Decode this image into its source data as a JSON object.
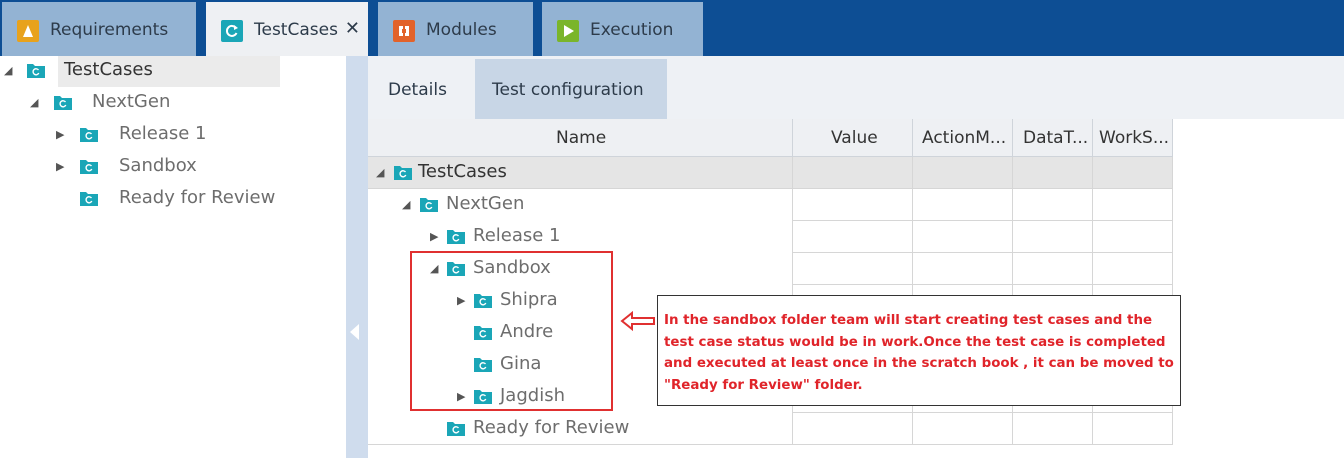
{
  "tabs": [
    {
      "label": "Requirements",
      "icon": "requirements-icon",
      "color": "#e8a21c",
      "active": false
    },
    {
      "label": "TestCases",
      "icon": "testcases-icon",
      "color": "#1aa6b7",
      "active": true,
      "close": "✕"
    },
    {
      "label": "Modules",
      "icon": "modules-icon",
      "color": "#e2622a",
      "active": false
    },
    {
      "label": "Execution",
      "icon": "execution-icon",
      "color": "#7ab52a",
      "active": false
    }
  ],
  "tree": {
    "root": "TestCases",
    "nextgen": "NextGen",
    "release1": "Release 1",
    "sandbox": "Sandbox",
    "ready": "Ready for Review"
  },
  "details_tabs": [
    "Details",
    "Test configuration"
  ],
  "grid": {
    "columns": [
      "Name",
      "Value",
      "ActionM...",
      "DataT...",
      "WorkS..."
    ],
    "rows": [
      "TestCases",
      "NextGen",
      "Release 1",
      "Sandbox",
      "Shipra",
      "Andre",
      "Gina",
      "Jagdish",
      "Ready for Review"
    ]
  },
  "annotation": {
    "text": "In the sandbox folder team will start creating test cases and the test case status would be in work.Once the test case is completed and executed at least once in the scratch book , it can be moved to \"Ready for Review\" folder.",
    "color": "#e0242a"
  },
  "colors": {
    "tabbar": "#0d4e94",
    "folder": "#1aa6b7"
  }
}
